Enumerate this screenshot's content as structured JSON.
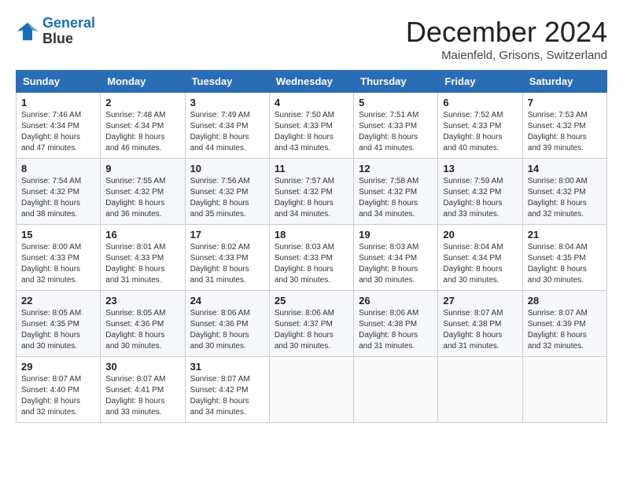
{
  "logo": {
    "line1": "General",
    "line2": "Blue"
  },
  "title": "December 2024",
  "subtitle": "Maienfeld, Grisons, Switzerland",
  "headers": [
    "Sunday",
    "Monday",
    "Tuesday",
    "Wednesday",
    "Thursday",
    "Friday",
    "Saturday"
  ],
  "weeks": [
    [
      {
        "day": "1",
        "sunrise": "7:46 AM",
        "sunset": "4:34 PM",
        "daylight": "8 hours and 47 minutes."
      },
      {
        "day": "2",
        "sunrise": "7:48 AM",
        "sunset": "4:34 PM",
        "daylight": "8 hours and 46 minutes."
      },
      {
        "day": "3",
        "sunrise": "7:49 AM",
        "sunset": "4:34 PM",
        "daylight": "8 hours and 44 minutes."
      },
      {
        "day": "4",
        "sunrise": "7:50 AM",
        "sunset": "4:33 PM",
        "daylight": "8 hours and 43 minutes."
      },
      {
        "day": "5",
        "sunrise": "7:51 AM",
        "sunset": "4:33 PM",
        "daylight": "8 hours and 41 minutes."
      },
      {
        "day": "6",
        "sunrise": "7:52 AM",
        "sunset": "4:33 PM",
        "daylight": "8 hours and 40 minutes."
      },
      {
        "day": "7",
        "sunrise": "7:53 AM",
        "sunset": "4:32 PM",
        "daylight": "8 hours and 39 minutes."
      }
    ],
    [
      {
        "day": "8",
        "sunrise": "7:54 AM",
        "sunset": "4:32 PM",
        "daylight": "8 hours and 38 minutes."
      },
      {
        "day": "9",
        "sunrise": "7:55 AM",
        "sunset": "4:32 PM",
        "daylight": "8 hours and 36 minutes."
      },
      {
        "day": "10",
        "sunrise": "7:56 AM",
        "sunset": "4:32 PM",
        "daylight": "8 hours and 35 minutes."
      },
      {
        "day": "11",
        "sunrise": "7:57 AM",
        "sunset": "4:32 PM",
        "daylight": "8 hours and 34 minutes."
      },
      {
        "day": "12",
        "sunrise": "7:58 AM",
        "sunset": "4:32 PM",
        "daylight": "8 hours and 34 minutes."
      },
      {
        "day": "13",
        "sunrise": "7:59 AM",
        "sunset": "4:32 PM",
        "daylight": "8 hours and 33 minutes."
      },
      {
        "day": "14",
        "sunrise": "8:00 AM",
        "sunset": "4:32 PM",
        "daylight": "8 hours and 32 minutes."
      }
    ],
    [
      {
        "day": "15",
        "sunrise": "8:00 AM",
        "sunset": "4:33 PM",
        "daylight": "8 hours and 32 minutes."
      },
      {
        "day": "16",
        "sunrise": "8:01 AM",
        "sunset": "4:33 PM",
        "daylight": "8 hours and 31 minutes."
      },
      {
        "day": "17",
        "sunrise": "8:02 AM",
        "sunset": "4:33 PM",
        "daylight": "8 hours and 31 minutes."
      },
      {
        "day": "18",
        "sunrise": "8:03 AM",
        "sunset": "4:33 PM",
        "daylight": "8 hours and 30 minutes."
      },
      {
        "day": "19",
        "sunrise": "8:03 AM",
        "sunset": "4:34 PM",
        "daylight": "8 hours and 30 minutes."
      },
      {
        "day": "20",
        "sunrise": "8:04 AM",
        "sunset": "4:34 PM",
        "daylight": "8 hours and 30 minutes."
      },
      {
        "day": "21",
        "sunrise": "8:04 AM",
        "sunset": "4:35 PM",
        "daylight": "8 hours and 30 minutes."
      }
    ],
    [
      {
        "day": "22",
        "sunrise": "8:05 AM",
        "sunset": "4:35 PM",
        "daylight": "8 hours and 30 minutes."
      },
      {
        "day": "23",
        "sunrise": "8:05 AM",
        "sunset": "4:36 PM",
        "daylight": "8 hours and 30 minutes."
      },
      {
        "day": "24",
        "sunrise": "8:06 AM",
        "sunset": "4:36 PM",
        "daylight": "8 hours and 30 minutes."
      },
      {
        "day": "25",
        "sunrise": "8:06 AM",
        "sunset": "4:37 PM",
        "daylight": "8 hours and 30 minutes."
      },
      {
        "day": "26",
        "sunrise": "8:06 AM",
        "sunset": "4:38 PM",
        "daylight": "8 hours and 31 minutes."
      },
      {
        "day": "27",
        "sunrise": "8:07 AM",
        "sunset": "4:38 PM",
        "daylight": "8 hours and 31 minutes."
      },
      {
        "day": "28",
        "sunrise": "8:07 AM",
        "sunset": "4:39 PM",
        "daylight": "8 hours and 32 minutes."
      }
    ],
    [
      {
        "day": "29",
        "sunrise": "8:07 AM",
        "sunset": "4:40 PM",
        "daylight": "8 hours and 32 minutes."
      },
      {
        "day": "30",
        "sunrise": "8:07 AM",
        "sunset": "4:41 PM",
        "daylight": "8 hours and 33 minutes."
      },
      {
        "day": "31",
        "sunrise": "8:07 AM",
        "sunset": "4:42 PM",
        "daylight": "8 hours and 34 minutes."
      },
      null,
      null,
      null,
      null
    ]
  ]
}
